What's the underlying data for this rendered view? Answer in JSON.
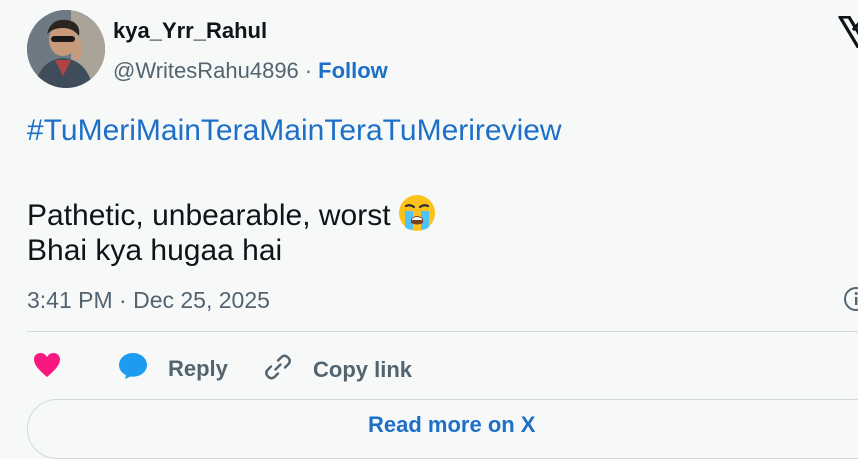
{
  "author": {
    "display_name": "kya_Yrr_Rahul",
    "handle": "@WritesRahu4896",
    "separator": "·",
    "follow_label": "Follow"
  },
  "tweet": {
    "hashtag": "#TuMeriMainTeraMainTeraTuMerireview",
    "line1": "Pathetic, unbearable, worst",
    "line2": "Bhai kya hugaa hai",
    "emoji": "loudly-crying-face-icon",
    "timestamp": "3:41 PM · Dec 25, 2025"
  },
  "actions": {
    "like_icon": "heart-icon",
    "reply_label": "Reply",
    "copy_link_label": "Copy link"
  },
  "footer": {
    "read_more_label": "Read more on X"
  },
  "colors": {
    "link": "#1d6fc7",
    "heart": "#f91880",
    "reply_bubble": "#1d9bf0",
    "secondary_text": "#536471",
    "background": "#f7f9f9"
  }
}
